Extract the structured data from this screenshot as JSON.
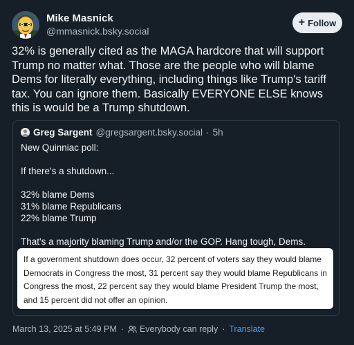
{
  "author": {
    "display_name": "Mike Masnick",
    "handle": "@mmasnick.bsky.social"
  },
  "follow_button": {
    "icon": "plus-icon",
    "label": "Follow"
  },
  "post": {
    "text": "32% is generally cited as the MAGA hardcore that will support Trump no matter what. Those are the people who will blame Dems for literally everything, including things like Trump's tariff tax. You can ignore them. Basically EVERYONE ELSE knows this is would be a Trump shutdown."
  },
  "quote": {
    "display_name": "Greg Sargent",
    "handle": "@gregsargent.bsky.social",
    "separator": "·",
    "time": "5h",
    "lines": [
      "New Quinniac poll:",
      "",
      "If there's a shutdown...",
      "",
      "32% blame Dems",
      "31% blame Republicans",
      "22% blame Trump",
      "",
      "That's a majority blaming Trump and/or the GOP. Hang tough, Dems."
    ],
    "image_lines": [
      "If a government shutdown does occur, 32 percent of voters say they would blame",
      "Democrats in Congress the most, 31 percent say they would blame Republicans in",
      "Congress the most, 22 percent say they would blame President Trump the most,",
      "and 15 percent did not offer an opinion."
    ]
  },
  "footer": {
    "timestamp": "March 13, 2025 at 5:49 PM",
    "separator1": "·",
    "reply_setting": "Everybody can reply",
    "separator2": "·",
    "translate": "Translate",
    "reply_icon": "people-icon"
  },
  "colors": {
    "background": "#161e27",
    "accent": "#4c9cf5",
    "muted": "#aebbc9"
  }
}
